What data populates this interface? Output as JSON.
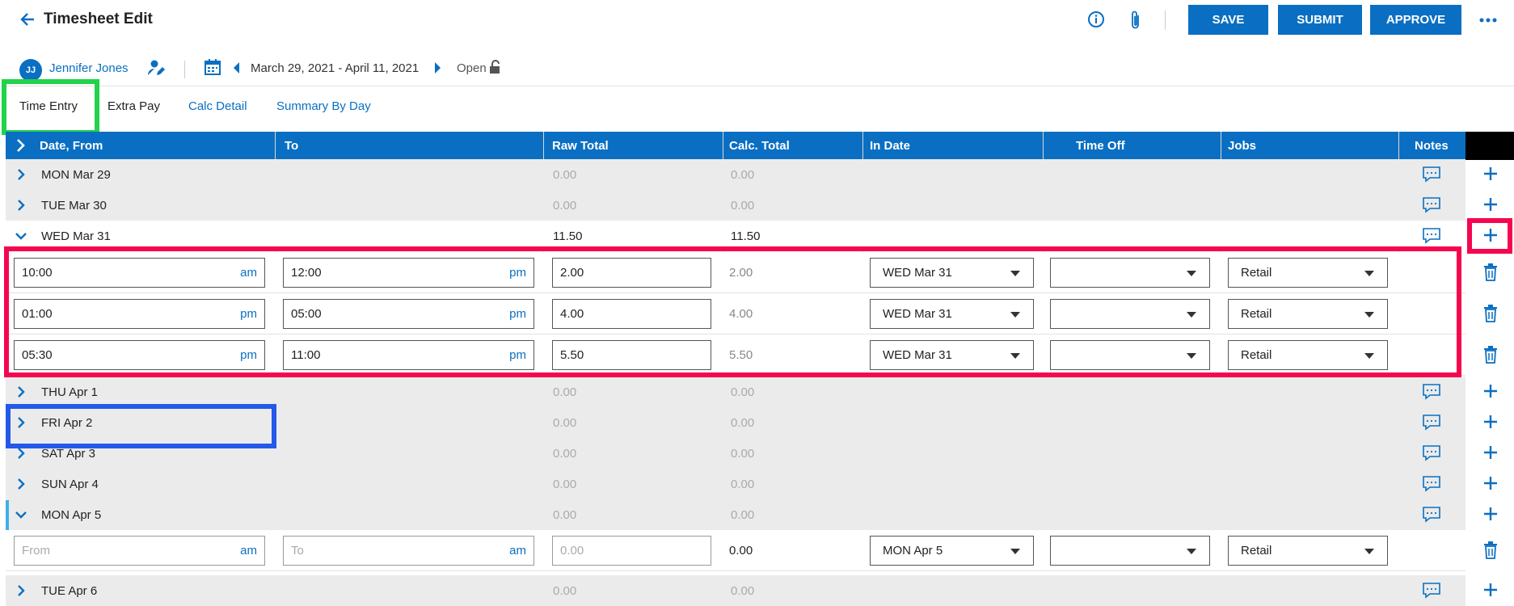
{
  "header": {
    "title": "Timesheet Edit",
    "save_label": "SAVE",
    "submit_label": "SUBMIT",
    "approve_label": "APPROVE"
  },
  "subheader": {
    "avatar_initials": "JJ",
    "employee_name": "Jennifer Jones",
    "period": "March 29, 2021 - April 11, 2021",
    "status": "Open"
  },
  "tabs": [
    {
      "label": "Time Entry",
      "active": true
    },
    {
      "label": "Extra Pay"
    },
    {
      "label": "Calc Detail"
    },
    {
      "label": "Summary By Day"
    }
  ],
  "columns": [
    "Date, From",
    "To",
    "Raw Total",
    "Calc. Total",
    "In Date",
    "Time Off",
    "Jobs",
    "Notes"
  ],
  "days": [
    {
      "label": "MON Mar 29",
      "raw": "0.00",
      "calc": "0.00",
      "expanded": false
    },
    {
      "label": "TUE Mar 30",
      "raw": "0.00",
      "calc": "0.00",
      "expanded": false
    },
    {
      "label": "WED Mar 31",
      "raw": "11.50",
      "calc": "11.50",
      "expanded": true
    },
    {
      "label": "THU Apr 1",
      "raw": "0.00",
      "calc": "0.00",
      "expanded": false
    },
    {
      "label": "FRI Apr 2",
      "raw": "0.00",
      "calc": "0.00",
      "expanded": false
    },
    {
      "label": "SAT Apr 3",
      "raw": "0.00",
      "calc": "0.00",
      "expanded": false
    },
    {
      "label": "SUN Apr 4",
      "raw": "0.00",
      "calc": "0.00",
      "expanded": false
    },
    {
      "label": "MON Apr 5",
      "raw": "0.00",
      "calc": "0.00",
      "expanded": true
    },
    {
      "label": "TUE Apr 6",
      "raw": "0.00",
      "calc": "0.00",
      "expanded": false
    }
  ],
  "entries": [
    {
      "from": "10:00",
      "from_ampm": "am",
      "to": "12:00",
      "to_ampm": "pm",
      "raw": "2.00",
      "calc": "2.00",
      "in_date": "WED Mar 31",
      "time_off": "",
      "job": "Retail"
    },
    {
      "from": "01:00",
      "from_ampm": "pm",
      "to": "05:00",
      "to_ampm": "pm",
      "raw": "4.00",
      "calc": "4.00",
      "in_date": "WED Mar 31",
      "time_off": "",
      "job": "Retail"
    },
    {
      "from": "05:30",
      "from_ampm": "pm",
      "to": "11:00",
      "to_ampm": "pm",
      "raw": "5.50",
      "calc": "5.50",
      "in_date": "WED Mar 31",
      "time_off": "",
      "job": "Retail"
    }
  ],
  "new_entry": {
    "from_placeholder": "From",
    "from_ampm": "am",
    "to_placeholder": "To",
    "to_ampm": "am",
    "raw_placeholder": "0.00",
    "calc": "0.00",
    "in_date": "MON Apr 5",
    "time_off": "",
    "job": "Retail"
  },
  "colors": {
    "accent": "#0a6fc2",
    "green_highlight": "#21d34a",
    "red_highlight": "#f5064f",
    "blue_highlight": "#2358e8"
  }
}
